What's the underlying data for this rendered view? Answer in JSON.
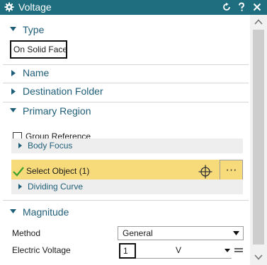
{
  "window": {
    "title": "Voltage"
  },
  "icons": {
    "settings": "gear-icon",
    "reset": "reset-icon",
    "help": "help-icon",
    "close": "close-icon",
    "select_check": "checkmark-icon",
    "crosshair": "crosshair-icon"
  },
  "colors": {
    "titlebar": "#1f6e80",
    "section_label": "#1f5e78",
    "active_selection": "#f7db7a",
    "sub_row_bg": "#eeeeee"
  },
  "sections": {
    "type": {
      "label": "Type",
      "value": "On Solid Face"
    },
    "name": {
      "label": "Name"
    },
    "destination_folder": {
      "label": "Destination Folder"
    },
    "primary_region": {
      "label": "Primary Region",
      "group_reference": {
        "label": "Group Reference",
        "checked": false
      },
      "body_focus": {
        "label": "Body Focus"
      },
      "select_object": {
        "label": "Select Object (1)",
        "more_label": "···"
      },
      "dividing_curve": {
        "label": "Dividing Curve"
      }
    },
    "magnitude": {
      "label": "Magnitude",
      "method": {
        "label": "Method",
        "value": "General"
      },
      "electric_voltage": {
        "label": "Electric Voltage",
        "value": "1",
        "unit": "V"
      }
    }
  }
}
